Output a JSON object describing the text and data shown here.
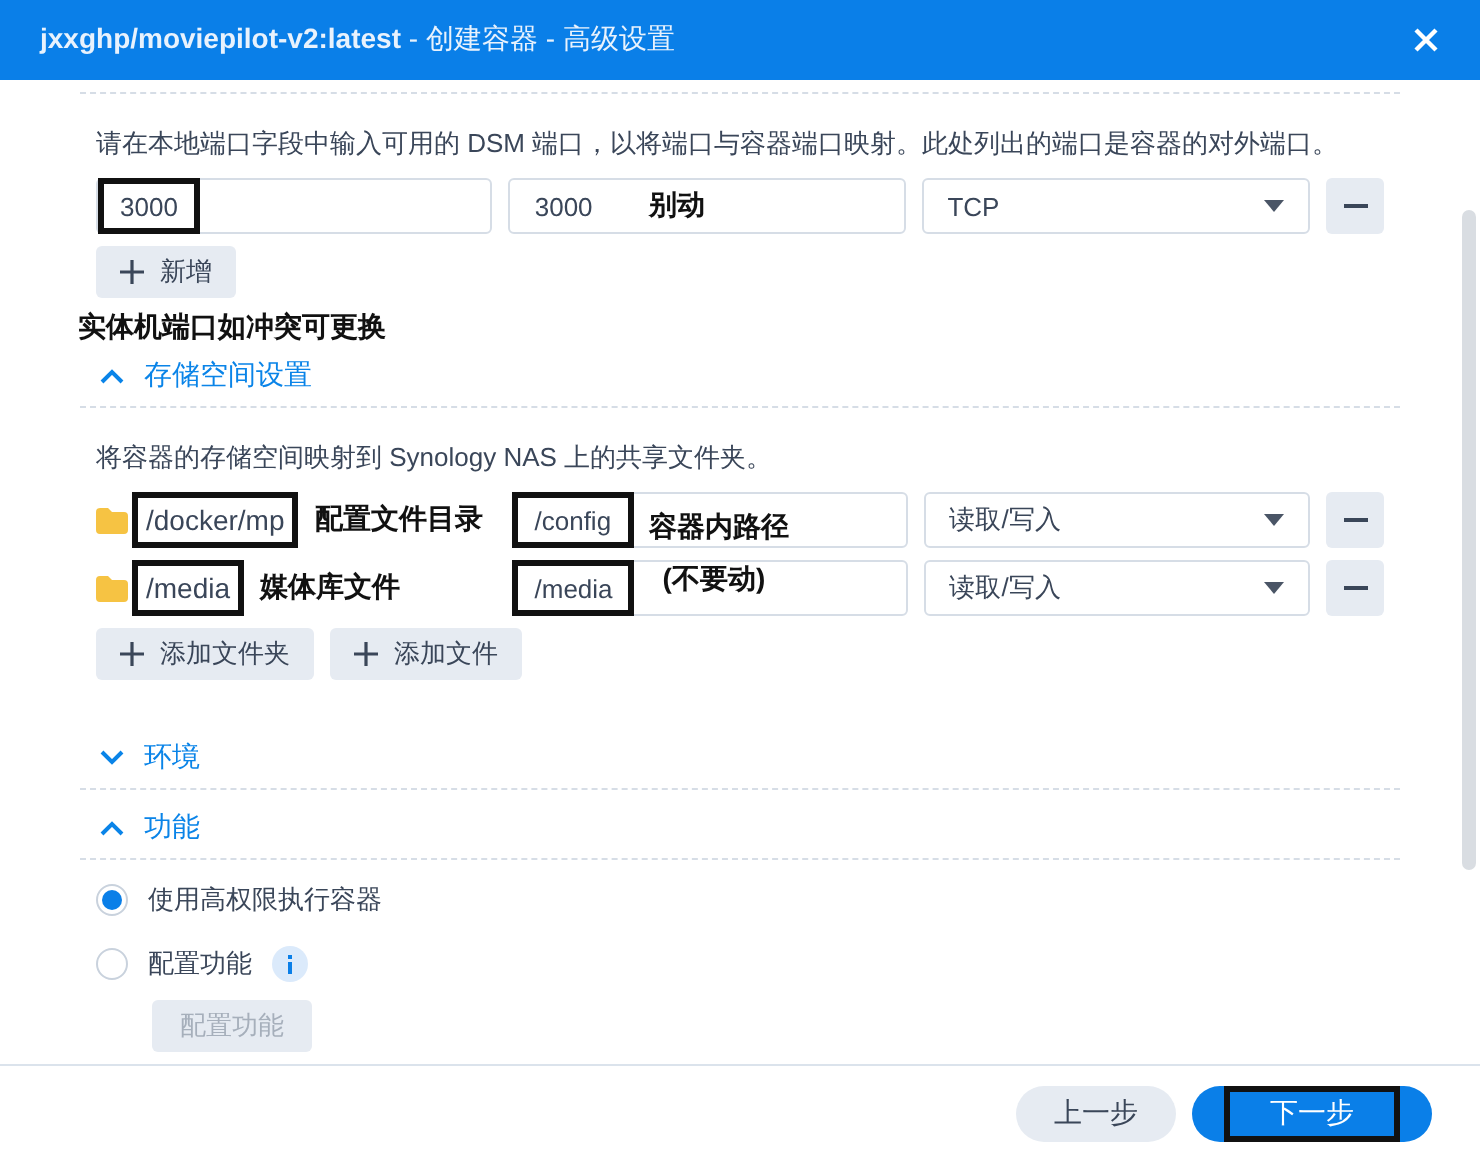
{
  "window": {
    "title": "**jxxghp/moviepilot-v2:latest** - 创建容器 - 高级设置"
  },
  "ports": {
    "description": "请在本地端口字段中输入可用的 DSM 端口，以将端口与容器端口映射。此处列出的端口是容器的对外端口。",
    "rows": [
      {
        "local": "3000",
        "local_highlighted": true,
        "container": "3000",
        "container_note": "别动",
        "protocol": "TCP"
      }
    ],
    "add_button": "新增",
    "note": "实体机端口如冲突可更换"
  },
  "storage": {
    "title": "存储空间设置",
    "expanded": true,
    "description": "将容器的存储空间映射到 Synology NAS 上的共享文件夹。",
    "rows": [
      {
        "folder": "/docker/mp",
        "folder_note": "配置文件目录",
        "mount": "/config",
        "mount_highlighted": true,
        "permission": "读取/写入"
      },
      {
        "folder": "/media",
        "folder_note": "媒体库文件",
        "mount": "/media",
        "mount_highlighted": true,
        "permission": "读取/写入"
      }
    ],
    "mount_note": [
      "容器内路径",
      "(不要动)"
    ],
    "buttons": [
      "添加文件夹",
      "添加文件"
    ]
  },
  "environment": {
    "title": "环境",
    "expanded": false
  },
  "features": {
    "title": "功能",
    "expanded": true,
    "options": [
      {
        "label": "使用高权限执行容器",
        "selected": true,
        "info": false
      },
      {
        "label": "配置功能",
        "selected": false,
        "info": true
      }
    ],
    "button": {
      "label": "配置功能",
      "disabled": true
    }
  },
  "footer": {
    "buttons": [
      {
        "label": "上一步",
        "kind": "secondary",
        "highlighted": false
      },
      {
        "label": "下一步",
        "kind": "primary",
        "highlighted": true
      }
    ]
  }
}
